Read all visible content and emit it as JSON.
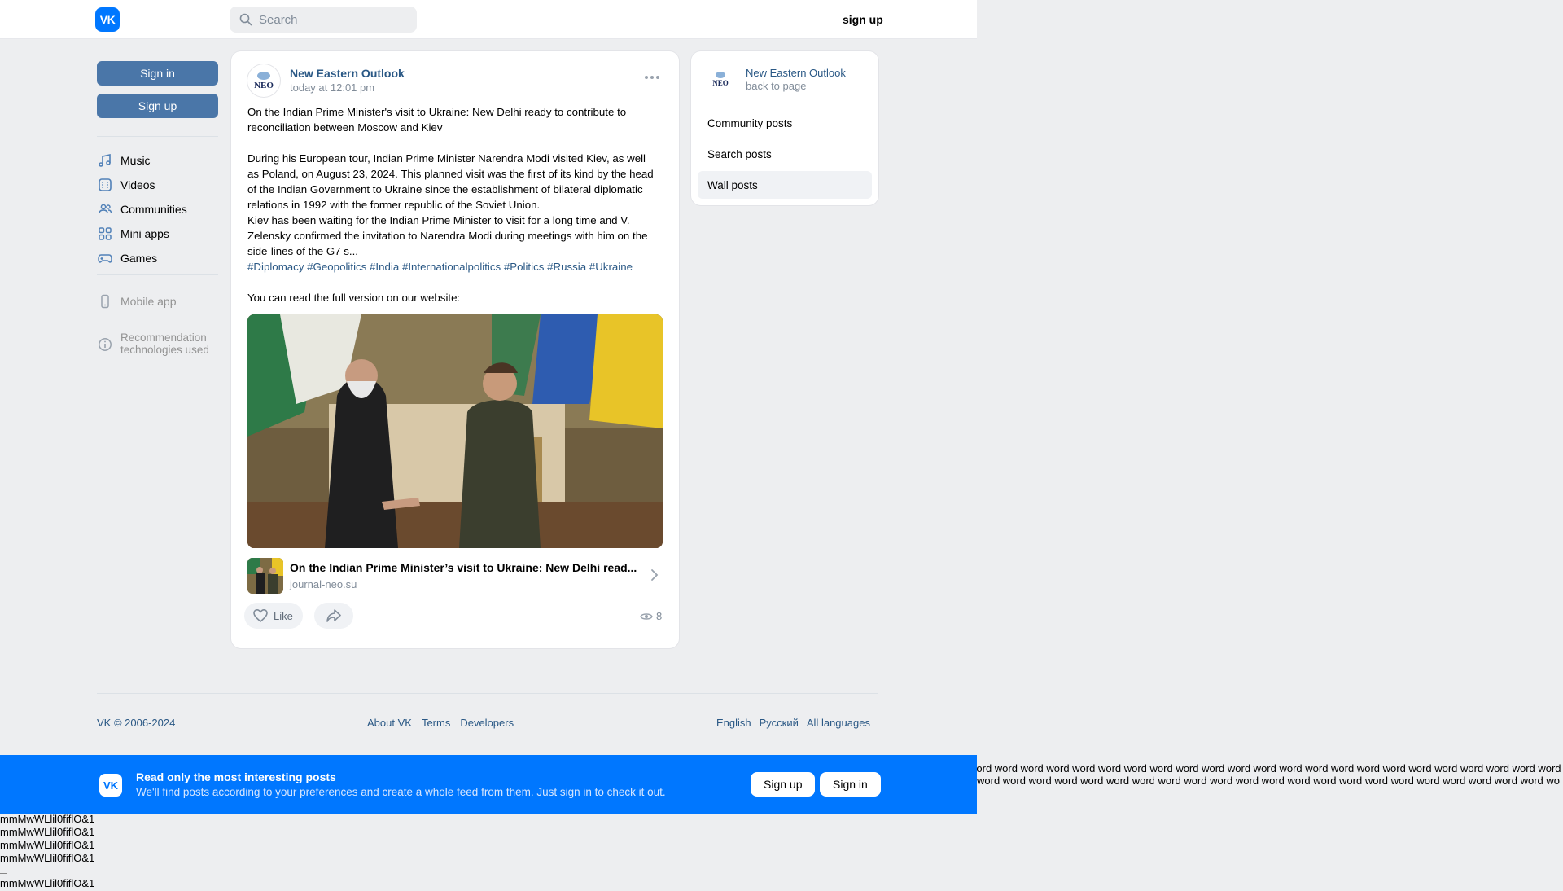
{
  "header": {
    "logo": "VK",
    "search_placeholder": "Search",
    "signup_label": "sign up"
  },
  "sidebar": {
    "sign_in_label": "Sign in",
    "sign_up_label": "Sign up",
    "items": [
      {
        "label": "Music",
        "icon": "music-icon"
      },
      {
        "label": "Videos",
        "icon": "video-icon"
      },
      {
        "label": "Communities",
        "icon": "people-icon"
      },
      {
        "label": "Mini apps",
        "icon": "apps-icon"
      },
      {
        "label": "Games",
        "icon": "gamepad-icon"
      }
    ],
    "secondary": [
      {
        "label": "Mobile app",
        "icon": "phone-icon"
      },
      {
        "label": "Recommendation technologies used",
        "line1": "Recommendation",
        "line2": "technologies used",
        "icon": "info-icon"
      }
    ]
  },
  "post": {
    "author": "New Eastern Outlook",
    "avatar_text": "NEO",
    "time": "today at 12:01 pm",
    "title_line1": "On the Indian Prime Minister's visit to Ukraine: New Delhi ready to contribute to",
    "title_line2": "reconciliation between Moscow and Kiev",
    "body_lines": [
      "During his European tour, Indian Prime Minister Narendra Modi visited Kiev, as well",
      "as Poland, on August 23, 2024. This planned visit was the first of its kind by the head",
      "of the Indian Government to Ukraine since the establishment of bilateral diplomatic",
      "relations in 1992 with the former republic of the Soviet Union.",
      "Kiev has been waiting for the Indian Prime Minister to visit for a long time and V.",
      "Zelensky confirmed the invitation to Narendra Modi during meetings with him on the",
      "side-lines of the G7 s..."
    ],
    "hashtags": "#Diplomacy #Geopolitics #India #Internationalpolitics #Politics #Russia #Ukraine",
    "read_more": "You can read the full version on our website:",
    "link_title": "On the Indian Prime Minister’s visit to Ukraine: New Delhi read...",
    "link_domain": "journal-neo.su",
    "like_label": "Like",
    "views": "8"
  },
  "right_card": {
    "name": "New Eastern Outlook",
    "avatar_text": "NEO",
    "back": "back to page",
    "items": [
      "Community posts",
      "Search posts",
      "Wall posts"
    ],
    "active_item": "Wall posts"
  },
  "footer": {
    "copyright": "VK © 2006-2024",
    "links": [
      "About VK",
      "Terms",
      "Developers"
    ],
    "languages": [
      "English",
      "Русский",
      "All languages"
    ]
  },
  "banner": {
    "title": "Read only the most interesting posts",
    "subtitle": "We'll find posts according to your preferences and create a whole feed from them. Just sign in to check it out.",
    "signup_label": "Sign up",
    "signin_label": "Sign in"
  },
  "artifacts": {
    "words": "word word word word word word word word word word word word word word word word word word word word word word word word word word word word word word word word word word word word word word word word word word word word word word word word word word word word word word word word word word word word word word word word word word word word word",
    "glyph_line": "mmMwWLlil0fiflO&1"
  },
  "colors": {
    "accent": "#0077ff",
    "button": "#4a76a8",
    "link": "#2a5885",
    "background": "#edeef0"
  }
}
